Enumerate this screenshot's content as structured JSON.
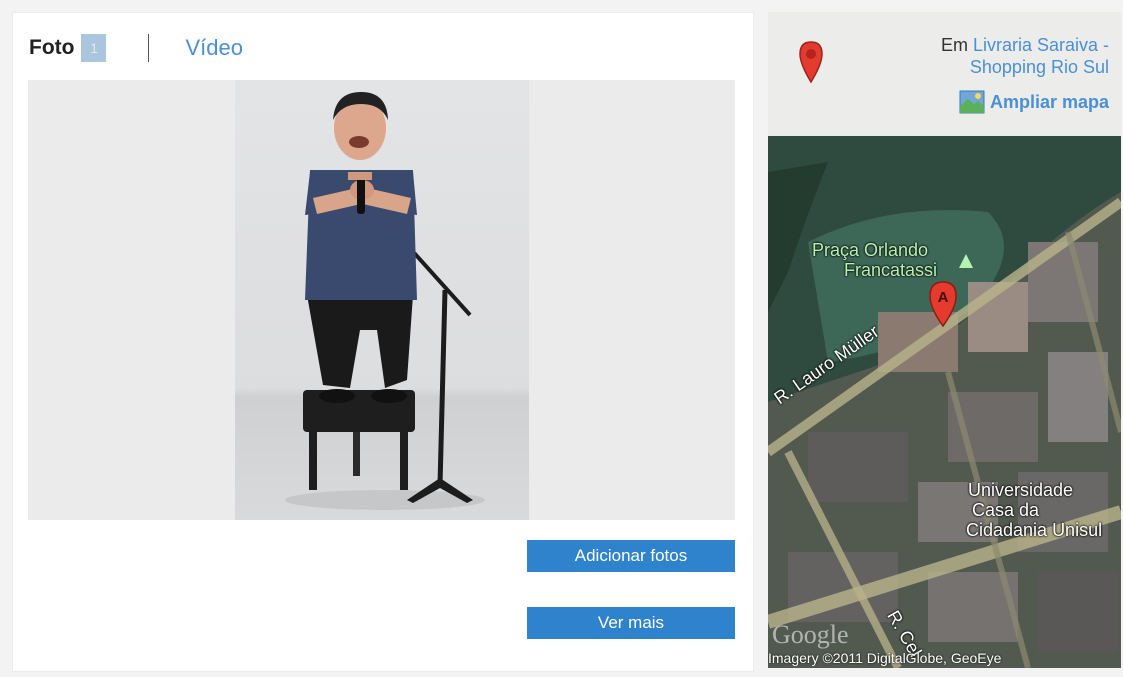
{
  "media": {
    "tab_photo": "Foto",
    "photo_count": "1",
    "tab_video": "Vídeo",
    "add_photos_label": "Adicionar fotos",
    "see_more_label": "Ver mais"
  },
  "map": {
    "location_prefix": "Em",
    "location_line1": "Livraria Saraiva -",
    "location_line2": "Shopping Rio Sul",
    "enlarge_label": "Ampliar mapa",
    "marker_letter": "A",
    "labels": {
      "park_line1": "Praça Orlando",
      "park_line2": "Francatassi",
      "street1": "R. Lauro Müller",
      "university_line1": "Universidade",
      "university_line2": "Casa da",
      "university_line3": "Cidadania Unisul",
      "street2": "R. Cel"
    },
    "logo": "Google",
    "copyright": "Imagery ©2011 DigitalGlobe, GeoEye"
  },
  "colors": {
    "accent": "#2f82cc",
    "link": "#4a90d6",
    "badge": "#a9c6dc"
  }
}
